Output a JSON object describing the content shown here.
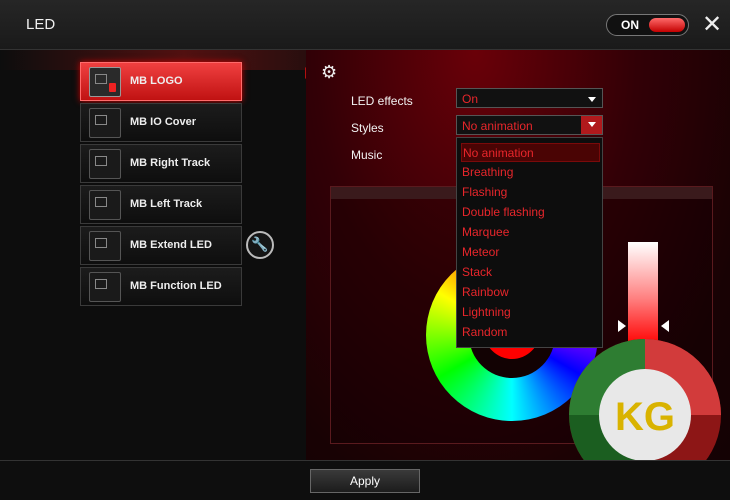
{
  "window": {
    "title": "LED"
  },
  "power": {
    "label": "ON"
  },
  "devices": [
    {
      "label": "MB LOGO"
    },
    {
      "label": "MB IO Cover"
    },
    {
      "label": "MB Right Track"
    },
    {
      "label": "MB Left Track"
    },
    {
      "label": "MB Extend LED"
    },
    {
      "label": "MB Function LED"
    }
  ],
  "settings": {
    "led_effects_label": "LED effects",
    "led_effects_value": "On",
    "styles_label": "Styles",
    "styles_value": "No animation",
    "music_label": "Music"
  },
  "styles_options": [
    "No animation",
    "Breathing",
    "Flashing",
    "Double flashing",
    "Marquee",
    "Meteor",
    "Stack",
    "Rainbow",
    "Lightning",
    "Random"
  ],
  "watermark": {
    "text": "KG"
  },
  "footer": {
    "apply_label": "Apply"
  },
  "colors": {
    "accent": "#e8262b",
    "active_item": "#d61a1a"
  }
}
